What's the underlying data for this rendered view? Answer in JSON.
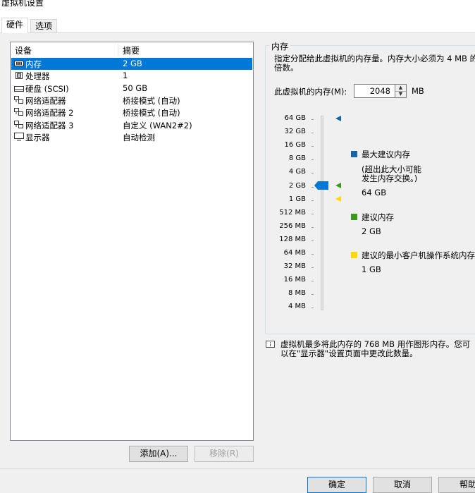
{
  "window": {
    "title": "虚拟机设置"
  },
  "tabs": [
    {
      "label": "硬件",
      "active": true
    },
    {
      "label": "选项",
      "active": false
    }
  ],
  "device_list": {
    "columns": [
      "设备",
      "摘要"
    ],
    "rows": [
      {
        "icon": "memory-icon",
        "name": "内存",
        "summary": "2 GB",
        "selected": true
      },
      {
        "icon": "cpu-icon",
        "name": "处理器",
        "summary": "1",
        "selected": false
      },
      {
        "icon": "disk-icon",
        "name": "硬盘 (SCSI)",
        "summary": "50 GB",
        "selected": false
      },
      {
        "icon": "network-adapter-icon",
        "name": "网络适配器",
        "summary": "桥接模式 (自动)",
        "selected": false
      },
      {
        "icon": "network-adapter-icon",
        "name": "网络适配器 2",
        "summary": "桥接模式 (自动)",
        "selected": false
      },
      {
        "icon": "network-adapter-icon",
        "name": "网络适配器 3",
        "summary": "自定义 (WAN2#2)",
        "selected": false
      },
      {
        "icon": "display-icon",
        "name": "显示器",
        "summary": "自动检测",
        "selected": false
      }
    ],
    "add_button": "添加(A)...",
    "remove_button": "移除(R)"
  },
  "memory": {
    "group_title": "内存",
    "description": "指定分配给此虚拟机的内存量。内存大小必须为 4 MB 的倍数。",
    "field_label": "此虚拟机的内存(M):",
    "value": "2048",
    "unit": "MB",
    "scale_labels": [
      "64 GB",
      "32 GB",
      "16 GB",
      "8 GB",
      "4 GB",
      "2 GB",
      "1 GB",
      "512 MB",
      "256 MB",
      "128 MB",
      "64 MB",
      "32 MB",
      "16 MB",
      "8 MB",
      "4 MB"
    ],
    "slider_value": "2 GB",
    "legend": {
      "max": {
        "title": "最大建议内存",
        "note": "(超出此大小可能\n发生内存交换。)",
        "value": "64 GB",
        "color": "#1565a8"
      },
      "recommended": {
        "title": "建议内存",
        "value": "2 GB",
        "color": "#3b9a1e"
      },
      "min": {
        "title": "建议的最小客户机操作系统内存",
        "value": "1 GB",
        "color": "#ffd800"
      }
    },
    "footnote": "虚拟机最多将此内存的 768 MB 用作图形内存。您可以在\"显示器\"设置页面中更改此数量。"
  },
  "dialog_buttons": {
    "ok": "确定",
    "cancel": "取消",
    "help": "帮助"
  }
}
